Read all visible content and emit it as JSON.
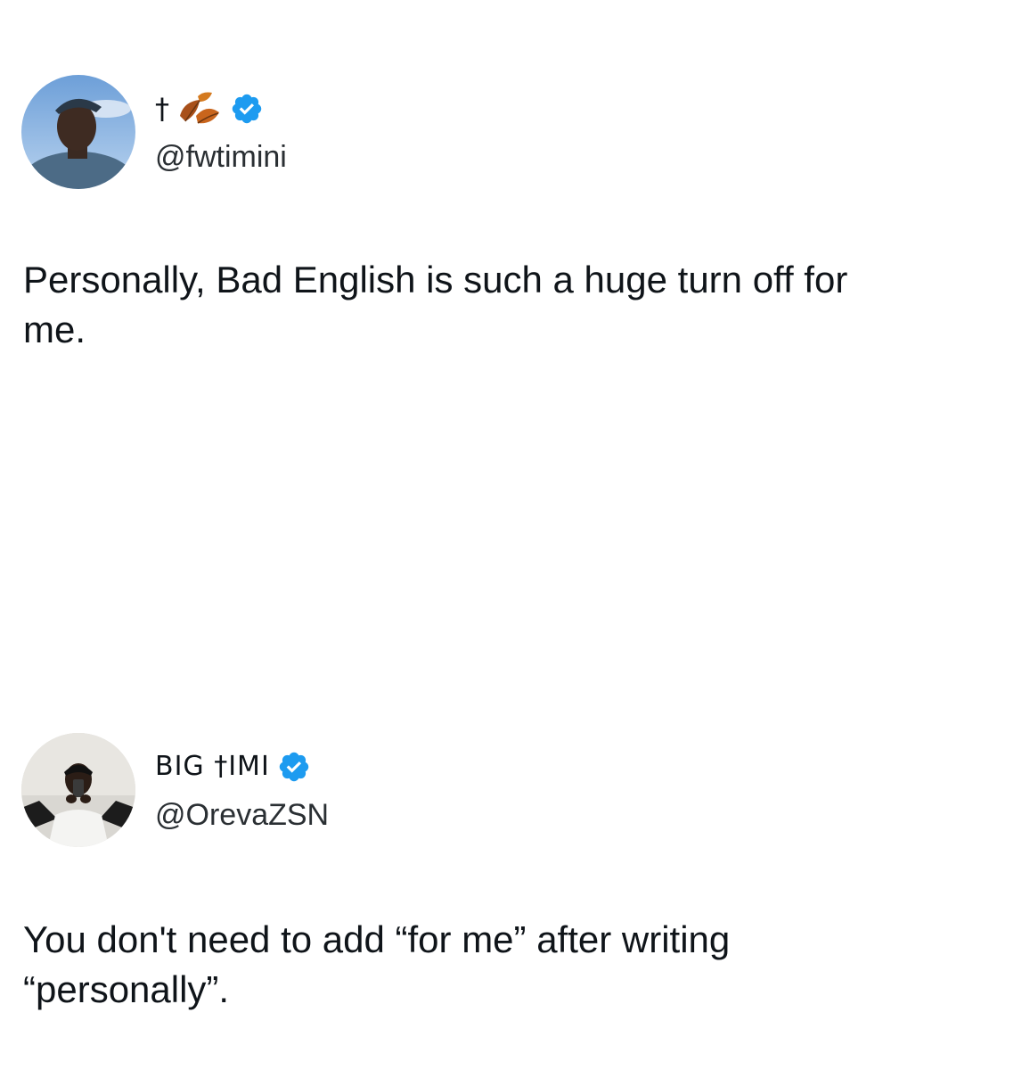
{
  "tweets": [
    {
      "display_name": "†",
      "display_icon": "fallen-leaf-emoji",
      "verified_icon": "verified-badge-icon",
      "handle": "@fwtimini",
      "text_line1": "Personally, Bad English is such a huge turn off for",
      "text_line2": "me."
    },
    {
      "display_name": "BIG †IMI",
      "verified_icon": "verified-badge-icon",
      "handle": "@OrevaZSN",
      "text_line1": "You don't need to add “for me” after writing",
      "text_line2": "“personally”."
    }
  ],
  "colors": {
    "text": "#0f1419",
    "handle": "#2a2f33",
    "verified": "#1d9bf0",
    "background": "#ffffff"
  }
}
